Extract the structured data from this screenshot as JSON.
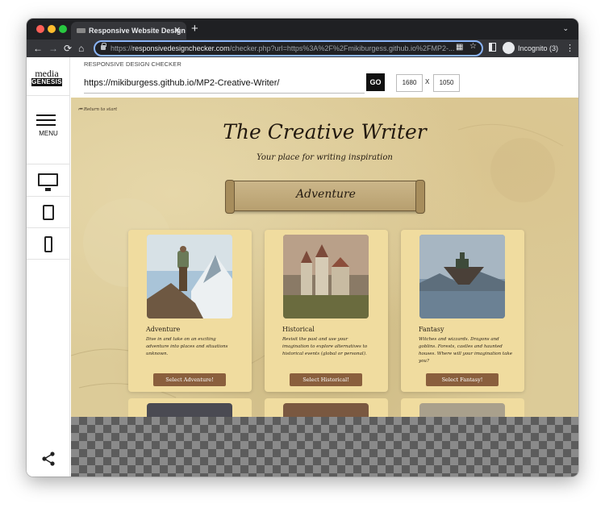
{
  "browser": {
    "tab_title": "Responsive Website Design Te",
    "tab_close": "✕",
    "new_tab": "+",
    "url_scheme": "https://",
    "url_host": "responsivedesignchecker.com",
    "url_rest": "/checker.php?url=https%3A%2F%2Fmikiburgess.github.io%2FMP2-...",
    "incognito_label": "Incognito (3)",
    "icons": [
      "back-icon",
      "forward-icon",
      "reload-icon",
      "lock-icon",
      "qr-icon",
      "star-icon",
      "side-panel-icon",
      "incognito-icon",
      "kebab-icon",
      "tab-search-icon"
    ]
  },
  "checker": {
    "logo_line1": "media",
    "logo_line2": "GENESIS",
    "menu_label": "MENU",
    "header_label": "RESPONSIVE DESIGN CHECKER",
    "url_value": "https://mikiburgess.github.io/MP2-Creative-Writer/",
    "go_label": "GO",
    "width_value": "1680",
    "x_label": "X",
    "height_value": "1050",
    "device_icons": [
      "desktop-icon",
      "tablet-icon",
      "phone-icon"
    ],
    "share_icon": "share-icon"
  },
  "site": {
    "return_link": "⏮ Return to start",
    "title": "The Creative Writer",
    "subtitle": "Your place for writing inspiration",
    "banner": "Adventure",
    "cards": [
      {
        "title": "Adventure",
        "description": "Dive in and take on an exciting adventure into places and situations unknown.",
        "button": "Select Adventure!"
      },
      {
        "title": "Historical",
        "description": "Revisit the past and use your imagination to explore alternatives to historical events (global or personal).",
        "button": "Select Historical!"
      },
      {
        "title": "Fantasy",
        "description": "Witches and wizzards. Dragons and goblins. Forests, castles and haunted houses. Where will your imagination take you?",
        "button": "Select Fantasy!"
      }
    ]
  },
  "colors": {
    "chrome_dark": "#1f2023",
    "toolbar": "#35363a",
    "omnibox_focus": "#8ab4f8",
    "parchment": "#dccb98",
    "card": "#f0dc9f",
    "button_brown": "#8a5f3d"
  }
}
